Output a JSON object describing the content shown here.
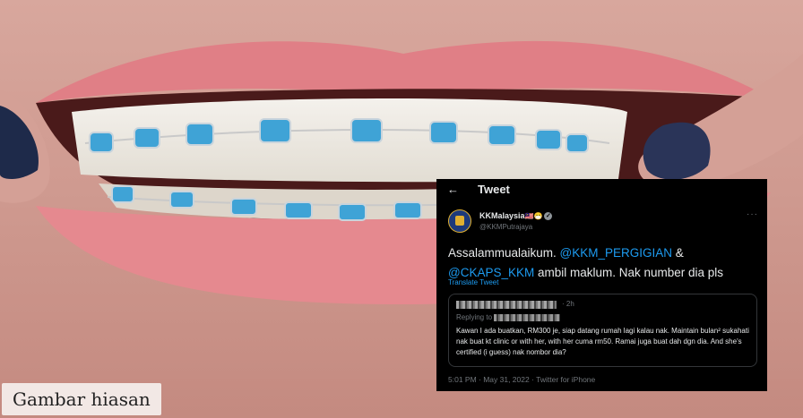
{
  "caption": "Gambar hiasan",
  "tweet": {
    "header_title": "Tweet",
    "author_name": "KKMalaysia",
    "author_flags": "🇲🇾😷",
    "author_handle": "@KKMPutrajaya",
    "text_part1": "Assalammualaikum. ",
    "mention1": "@KKM_PERGIGIAN",
    "text_part2": " & ",
    "mention2": "@CKAPS_KKM",
    "text_part3": " ambil maklum. Nak number dia pls",
    "translate_label": "Translate Tweet",
    "quote": {
      "time": "· 2h",
      "replying_to_label": "Replying to",
      "text": "Kawan I ada buatkan, RM300 je, siap datang rumah lagi kalau nak. Maintain bulan² sukahati nak buat kt clinic or with her, with her cuma rm50. Ramai juga buat dah dgn dia. And she's certified (i guess) nak nombor dia?"
    },
    "footer": "5:01 PM · May 31, 2022 · Twitter for iPhone"
  },
  "colors": {
    "background": "#000000",
    "mention": "#1d9bf0",
    "secondary_text": "#71767b"
  },
  "icons": [
    "back-arrow-icon",
    "verified-icon",
    "more-icon"
  ]
}
